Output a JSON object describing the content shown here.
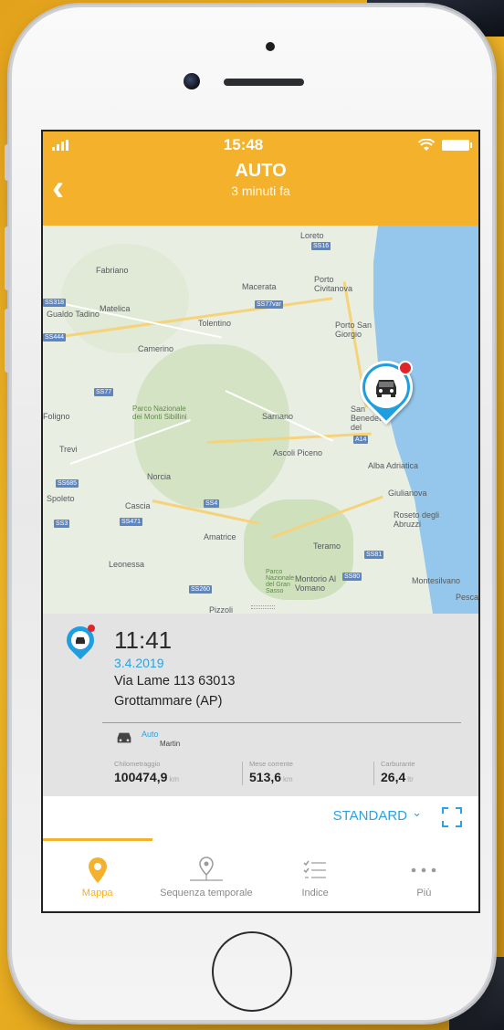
{
  "status_bar": {
    "time": "15:48"
  },
  "header": {
    "title": "AUTO",
    "subtitle": "3 minuti fa",
    "back_label": "‹"
  },
  "map": {
    "places": [
      {
        "name": "Loreto"
      },
      {
        "name": "Fabriano"
      },
      {
        "name": "Macerata"
      },
      {
        "name": "Porto Civitanova"
      },
      {
        "name": "Gualdo Tadino"
      },
      {
        "name": "Matelica"
      },
      {
        "name": "Tolentino"
      },
      {
        "name": "Porto San Giorgio"
      },
      {
        "name": "Camerino"
      },
      {
        "name": "Foligno"
      },
      {
        "name": "Parco Nazionale dei Monti Sibillini"
      },
      {
        "name": "Sarnano"
      },
      {
        "name": "San Benedetto del"
      },
      {
        "name": "Trevi"
      },
      {
        "name": "Ascoli Piceno"
      },
      {
        "name": "Alba Adriatica"
      },
      {
        "name": "Norcia"
      },
      {
        "name": "Spoleto"
      },
      {
        "name": "Cascia"
      },
      {
        "name": "Giulianova"
      },
      {
        "name": "Roseto degli Abruzzi"
      },
      {
        "name": "Amatrice"
      },
      {
        "name": "Teramo"
      },
      {
        "name": "Leonessa"
      },
      {
        "name": "Montorio Al Vomano"
      },
      {
        "name": "Parco Nazionale del Gran Sasso"
      },
      {
        "name": "Montesilvano"
      },
      {
        "name": "Pizzoli"
      },
      {
        "name": "Pesca"
      }
    ]
  },
  "info": {
    "time": "11:41",
    "date": "3.4.2019",
    "address_line1": "Via Lame 113 63013",
    "address_line2": "Grottammare (AP)",
    "vehicle_name": "Auto",
    "driver": "Martin",
    "stats": [
      {
        "label": "Chilometraggio",
        "value": "100474,9",
        "unit": "km"
      },
      {
        "label": "Mese corrente",
        "value": "513,6",
        "unit": "km"
      },
      {
        "label": "Carburante",
        "value": "26,4",
        "unit": "ltr"
      }
    ]
  },
  "toolbar": {
    "map_type": "STANDARD",
    "chevron": "⌄"
  },
  "tabs": [
    {
      "label": "Mappa",
      "icon": "location-pin-icon"
    },
    {
      "label": "Sequenza temporale",
      "icon": "timeline-icon"
    },
    {
      "label": "Indice",
      "icon": "checklist-icon"
    },
    {
      "label": "Più",
      "icon": "more-dots-icon"
    }
  ],
  "colors": {
    "accent": "#f4b12b",
    "blue": "#2aa3e0",
    "alert": "#e0262b"
  }
}
